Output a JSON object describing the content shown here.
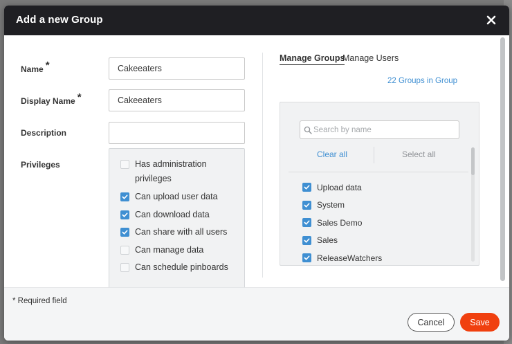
{
  "modal": {
    "title": "Add a new Group"
  },
  "form": {
    "name_label": "Name",
    "name_value": "Cakeeaters",
    "display_name_label": "Display Name",
    "display_name_value": "Cakeeaters",
    "description_label": "Description",
    "description_value": "",
    "privileges_label": "Privileges",
    "required_marker": "*",
    "privileges": [
      {
        "label": "Has administration privileges",
        "checked": false
      },
      {
        "label": "Can upload user data",
        "checked": true
      },
      {
        "label": "Can download data",
        "checked": true
      },
      {
        "label": "Can share with all users",
        "checked": true
      },
      {
        "label": "Can manage data",
        "checked": false
      },
      {
        "label": "Can schedule pinboards",
        "checked": false
      }
    ]
  },
  "tabs": {
    "manage_groups": "Manage Groups",
    "manage_users": "Manage Users",
    "active": "Manage Groups"
  },
  "groups_panel": {
    "count_text": "22 Groups in Group",
    "search_placeholder": "Search by name",
    "search_value": "",
    "clear_all": "Clear all",
    "select_all": "Select all",
    "items": [
      {
        "label": "Upload data",
        "checked": true
      },
      {
        "label": "System",
        "checked": true
      },
      {
        "label": "Sales Demo",
        "checked": true
      },
      {
        "label": "Sales",
        "checked": true
      },
      {
        "label": "ReleaseWatchers",
        "checked": true
      }
    ]
  },
  "footer": {
    "required_note": "* Required field",
    "cancel_label": "Cancel",
    "save_label": "Save"
  },
  "colors": {
    "header_bg": "#1f1f23",
    "accent_blue": "#3f8fd2",
    "save_orange": "#f0400f"
  },
  "icons": {
    "close": "close-icon",
    "search": "search-icon",
    "checkbox_checked": "check-icon"
  }
}
